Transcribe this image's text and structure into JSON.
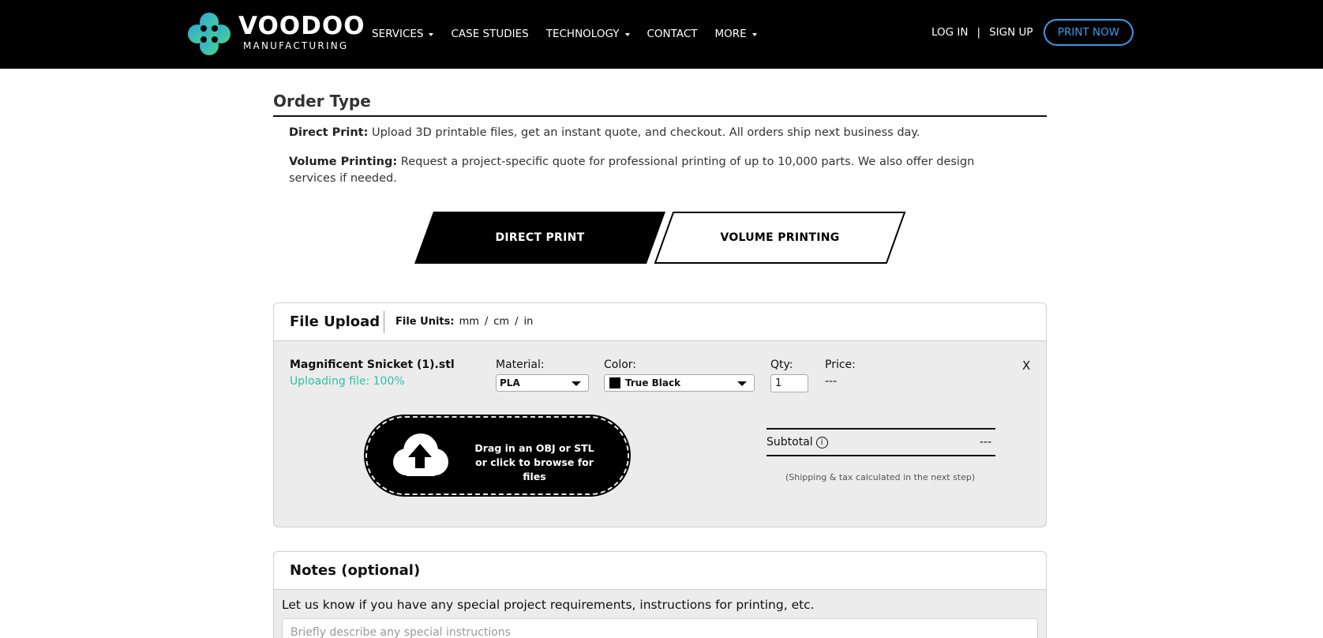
{
  "brand": {
    "word": "VOODOO",
    "sub": "MANUFACTURING"
  },
  "nav": {
    "items": [
      {
        "label": "SERVICES",
        "dropdown": true
      },
      {
        "label": "CASE STUDIES",
        "dropdown": false
      },
      {
        "label": "TECHNOLOGY",
        "dropdown": true
      },
      {
        "label": "CONTACT",
        "dropdown": false
      },
      {
        "label": "MORE",
        "dropdown": true
      }
    ],
    "login": "LOG IN",
    "separator": "|",
    "signup": "SIGN UP",
    "cta": "PRINT NOW"
  },
  "order_type": {
    "title": "Order Type",
    "direct_label": "Direct Print:",
    "direct_text": " Upload 3D printable files, get an instant quote, and checkout. All orders ship next business day.",
    "volume_label": "Volume Printing:",
    "volume_text": " Request a project-specific quote for professional printing of up to 10,000 parts. We also offer design services if needed.",
    "tabs": [
      "DIRECT PRINT",
      "VOLUME PRINTING"
    ],
    "active_tab": "DIRECT PRINT"
  },
  "file_upload": {
    "title": "File Upload",
    "units_label": "File Units:",
    "units": [
      "mm",
      "cm",
      "in"
    ],
    "slash": "/",
    "file": {
      "name": "Magnificent Snicket (1).stl",
      "status": "Uploading file: 100%",
      "material_label": "Material:",
      "material": "PLA",
      "color_label": "Color:",
      "color": "True Black",
      "qty_label": "Qty:",
      "qty": "1",
      "price_label": "Price:",
      "price": "---",
      "remove": "X"
    },
    "dropzone": {
      "line1": "Drag in an OBJ or STL",
      "line2": "or click to browse for files",
      "icon": "cloud-upload-icon"
    },
    "subtotal_label": "Subtotal",
    "info_glyph": "i",
    "subtotal_value": "---",
    "shipping_note": "(Shipping & tax calculated in the next step)"
  },
  "notes": {
    "title": "Notes (optional)",
    "help": "Let us know if you have any special project requirements, instructions for printing, etc.",
    "placeholder": "Briefly describe any special instructions"
  },
  "colors": {
    "accent_blue": "#3b9be8",
    "status_green": "#2fc2a5",
    "panel_gray": "#ececec"
  }
}
